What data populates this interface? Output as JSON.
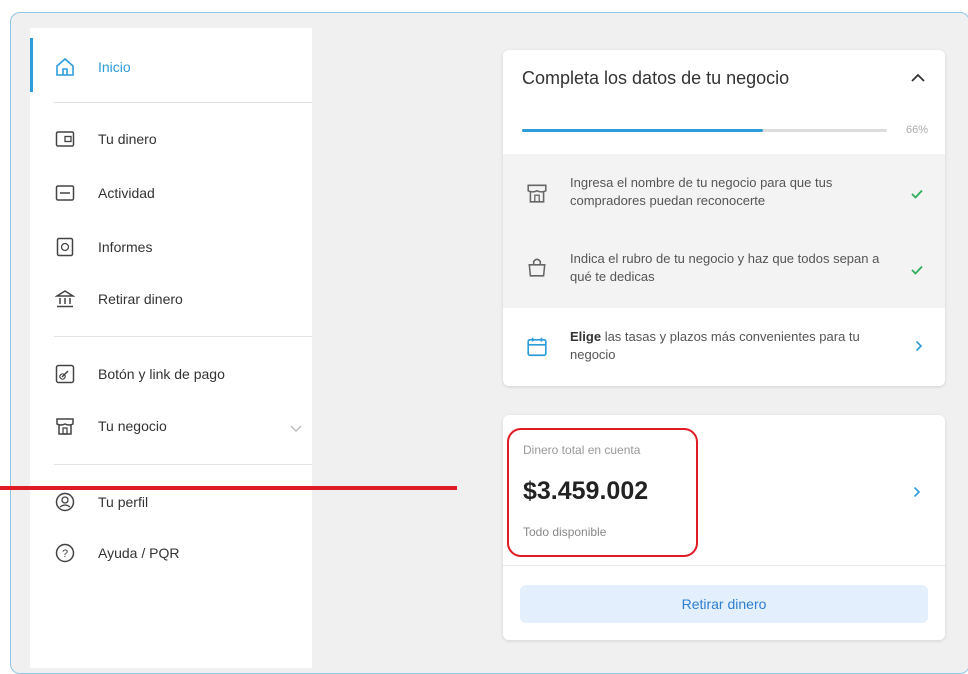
{
  "sidebar": {
    "items": [
      {
        "label": "Inicio",
        "icon": "home-icon"
      },
      {
        "label": "Tu dinero",
        "icon": "wallet-icon"
      },
      {
        "label": "Actividad",
        "icon": "activity-icon"
      },
      {
        "label": "Informes",
        "icon": "report-icon"
      },
      {
        "label": "Retirar dinero",
        "icon": "bank-icon"
      },
      {
        "label": "Botón y link de pago",
        "icon": "link-icon"
      },
      {
        "label": "Tu negocio",
        "icon": "store-icon"
      },
      {
        "label": "Tu perfil",
        "icon": "profile-icon"
      },
      {
        "label": "Ayuda / PQR",
        "icon": "help-icon"
      }
    ]
  },
  "onboarding": {
    "title": "Completa los datos de tu negocio",
    "progress_label": "66%",
    "progress_value": 0.66,
    "tasks": [
      {
        "text": "Ingresa el nombre de tu negocio para que tus compradores puedan reconocerte",
        "status": "done"
      },
      {
        "text": "Indica el rubro de tu negocio y haz que todos sepan a qué te dedicas",
        "status": "done"
      },
      {
        "text_bold": "Elige",
        "text": " las tasas y plazos más convenientes para tu negocio",
        "status": "pending"
      }
    ]
  },
  "balance": {
    "label": "Dinero total en cuenta",
    "amount": "$3.459.002",
    "sub": "Todo disponible",
    "button": "Retirar dinero"
  },
  "colors": {
    "accent": "#2d9cdb",
    "success": "#2eae5a",
    "annotation": "#e01b24"
  }
}
